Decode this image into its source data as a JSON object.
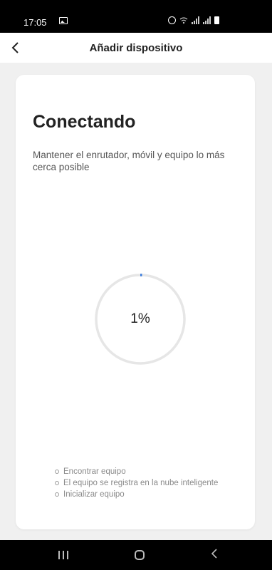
{
  "status_bar": {
    "time": "17:05",
    "icons": [
      "image-icon",
      "alarm-icon",
      "wifi-icon",
      "signal-icon",
      "signal-icon",
      "battery-icon"
    ]
  },
  "header": {
    "back_icon": "chevron-left-icon",
    "title": "Añadir dispositivo"
  },
  "card": {
    "title": "Conectando",
    "description": "Mantener el enrutador, móvil y equipo lo más cerca posible",
    "progress": {
      "value": 1,
      "label": "1%",
      "track_color": "#e6e6e6",
      "fill_color": "#3b7ddd"
    },
    "steps": [
      "Encontrar equipo",
      "El equipo se registra en la nube inteligente",
      "Inicializar equipo"
    ]
  },
  "nav_bar": {
    "icons": [
      "recents-icon",
      "home-icon",
      "back-icon"
    ]
  }
}
